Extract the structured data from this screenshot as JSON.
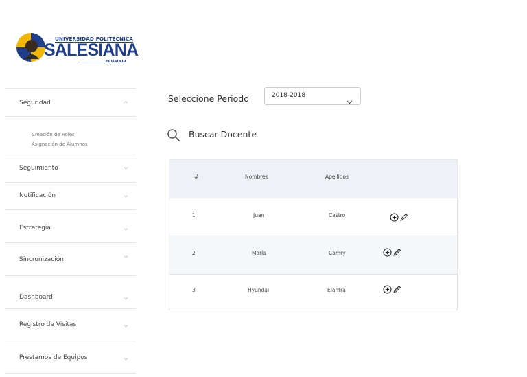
{
  "logo": {
    "line1": "UNIVERSIDAD POLITÉCNICA",
    "line2": "SALESIANA",
    "line3": "ECUADOR"
  },
  "sidebar": {
    "items": [
      {
        "label": "Seguridad",
        "expanded": true,
        "subitems": [
          "Creación de Roles",
          "Asignación de Alumnos"
        ]
      },
      {
        "label": "Seguimiento"
      },
      {
        "label": "Notificación"
      },
      {
        "label": "Estrategia"
      },
      {
        "label": "Sincronización"
      },
      {
        "label": "Dashboard"
      },
      {
        "label": "Registro de Visitas"
      },
      {
        "label": "Prestamos de Equipos"
      }
    ]
  },
  "main": {
    "period_label": "Seleccione Periodo",
    "period_value": "2018-2018",
    "search_label": "Buscar Docente"
  },
  "table": {
    "headers": [
      "#",
      "Nombres",
      "Apellidos"
    ],
    "rows": [
      {
        "num": "1",
        "nombre": "Juan",
        "apellido": "Castro"
      },
      {
        "num": "2",
        "nombre": "María",
        "apellido": "Camry"
      },
      {
        "num": "3",
        "nombre": "Hyundai",
        "apellido": "Elantra"
      }
    ]
  },
  "icons": [
    "chevron-up-icon",
    "chevron-down-icon",
    "search-icon",
    "add-circle-icon",
    "pencil-icon"
  ],
  "colors": {
    "brand": "#1f3f8c",
    "header_bg": "#eef1f5",
    "border": "#e6e6e6"
  }
}
